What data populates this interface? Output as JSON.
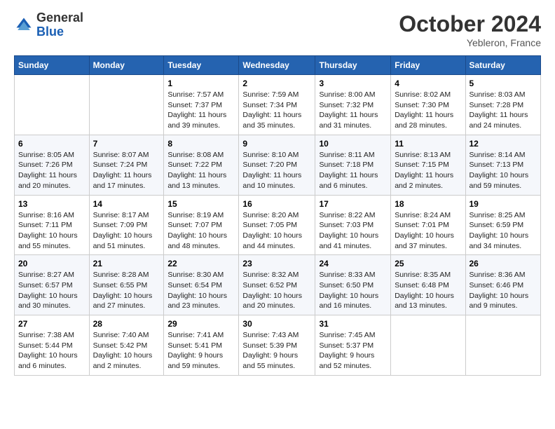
{
  "logo": {
    "general": "General",
    "blue": "Blue"
  },
  "header": {
    "month": "October 2024",
    "location": "Yebleron, France"
  },
  "weekdays": [
    "Sunday",
    "Monday",
    "Tuesday",
    "Wednesday",
    "Thursday",
    "Friday",
    "Saturday"
  ],
  "weeks": [
    [
      {
        "day": "",
        "info": ""
      },
      {
        "day": "",
        "info": ""
      },
      {
        "day": "1",
        "info": "Sunrise: 7:57 AM\nSunset: 7:37 PM\nDaylight: 11 hours and 39 minutes."
      },
      {
        "day": "2",
        "info": "Sunrise: 7:59 AM\nSunset: 7:34 PM\nDaylight: 11 hours and 35 minutes."
      },
      {
        "day": "3",
        "info": "Sunrise: 8:00 AM\nSunset: 7:32 PM\nDaylight: 11 hours and 31 minutes."
      },
      {
        "day": "4",
        "info": "Sunrise: 8:02 AM\nSunset: 7:30 PM\nDaylight: 11 hours and 28 minutes."
      },
      {
        "day": "5",
        "info": "Sunrise: 8:03 AM\nSunset: 7:28 PM\nDaylight: 11 hours and 24 minutes."
      }
    ],
    [
      {
        "day": "6",
        "info": "Sunrise: 8:05 AM\nSunset: 7:26 PM\nDaylight: 11 hours and 20 minutes."
      },
      {
        "day": "7",
        "info": "Sunrise: 8:07 AM\nSunset: 7:24 PM\nDaylight: 11 hours and 17 minutes."
      },
      {
        "day": "8",
        "info": "Sunrise: 8:08 AM\nSunset: 7:22 PM\nDaylight: 11 hours and 13 minutes."
      },
      {
        "day": "9",
        "info": "Sunrise: 8:10 AM\nSunset: 7:20 PM\nDaylight: 11 hours and 10 minutes."
      },
      {
        "day": "10",
        "info": "Sunrise: 8:11 AM\nSunset: 7:18 PM\nDaylight: 11 hours and 6 minutes."
      },
      {
        "day": "11",
        "info": "Sunrise: 8:13 AM\nSunset: 7:15 PM\nDaylight: 11 hours and 2 minutes."
      },
      {
        "day": "12",
        "info": "Sunrise: 8:14 AM\nSunset: 7:13 PM\nDaylight: 10 hours and 59 minutes."
      }
    ],
    [
      {
        "day": "13",
        "info": "Sunrise: 8:16 AM\nSunset: 7:11 PM\nDaylight: 10 hours and 55 minutes."
      },
      {
        "day": "14",
        "info": "Sunrise: 8:17 AM\nSunset: 7:09 PM\nDaylight: 10 hours and 51 minutes."
      },
      {
        "day": "15",
        "info": "Sunrise: 8:19 AM\nSunset: 7:07 PM\nDaylight: 10 hours and 48 minutes."
      },
      {
        "day": "16",
        "info": "Sunrise: 8:20 AM\nSunset: 7:05 PM\nDaylight: 10 hours and 44 minutes."
      },
      {
        "day": "17",
        "info": "Sunrise: 8:22 AM\nSunset: 7:03 PM\nDaylight: 10 hours and 41 minutes."
      },
      {
        "day": "18",
        "info": "Sunrise: 8:24 AM\nSunset: 7:01 PM\nDaylight: 10 hours and 37 minutes."
      },
      {
        "day": "19",
        "info": "Sunrise: 8:25 AM\nSunset: 6:59 PM\nDaylight: 10 hours and 34 minutes."
      }
    ],
    [
      {
        "day": "20",
        "info": "Sunrise: 8:27 AM\nSunset: 6:57 PM\nDaylight: 10 hours and 30 minutes."
      },
      {
        "day": "21",
        "info": "Sunrise: 8:28 AM\nSunset: 6:55 PM\nDaylight: 10 hours and 27 minutes."
      },
      {
        "day": "22",
        "info": "Sunrise: 8:30 AM\nSunset: 6:54 PM\nDaylight: 10 hours and 23 minutes."
      },
      {
        "day": "23",
        "info": "Sunrise: 8:32 AM\nSunset: 6:52 PM\nDaylight: 10 hours and 20 minutes."
      },
      {
        "day": "24",
        "info": "Sunrise: 8:33 AM\nSunset: 6:50 PM\nDaylight: 10 hours and 16 minutes."
      },
      {
        "day": "25",
        "info": "Sunrise: 8:35 AM\nSunset: 6:48 PM\nDaylight: 10 hours and 13 minutes."
      },
      {
        "day": "26",
        "info": "Sunrise: 8:36 AM\nSunset: 6:46 PM\nDaylight: 10 hours and 9 minutes."
      }
    ],
    [
      {
        "day": "27",
        "info": "Sunrise: 7:38 AM\nSunset: 5:44 PM\nDaylight: 10 hours and 6 minutes."
      },
      {
        "day": "28",
        "info": "Sunrise: 7:40 AM\nSunset: 5:42 PM\nDaylight: 10 hours and 2 minutes."
      },
      {
        "day": "29",
        "info": "Sunrise: 7:41 AM\nSunset: 5:41 PM\nDaylight: 9 hours and 59 minutes."
      },
      {
        "day": "30",
        "info": "Sunrise: 7:43 AM\nSunset: 5:39 PM\nDaylight: 9 hours and 55 minutes."
      },
      {
        "day": "31",
        "info": "Sunrise: 7:45 AM\nSunset: 5:37 PM\nDaylight: 9 hours and 52 minutes."
      },
      {
        "day": "",
        "info": ""
      },
      {
        "day": "",
        "info": ""
      }
    ]
  ]
}
